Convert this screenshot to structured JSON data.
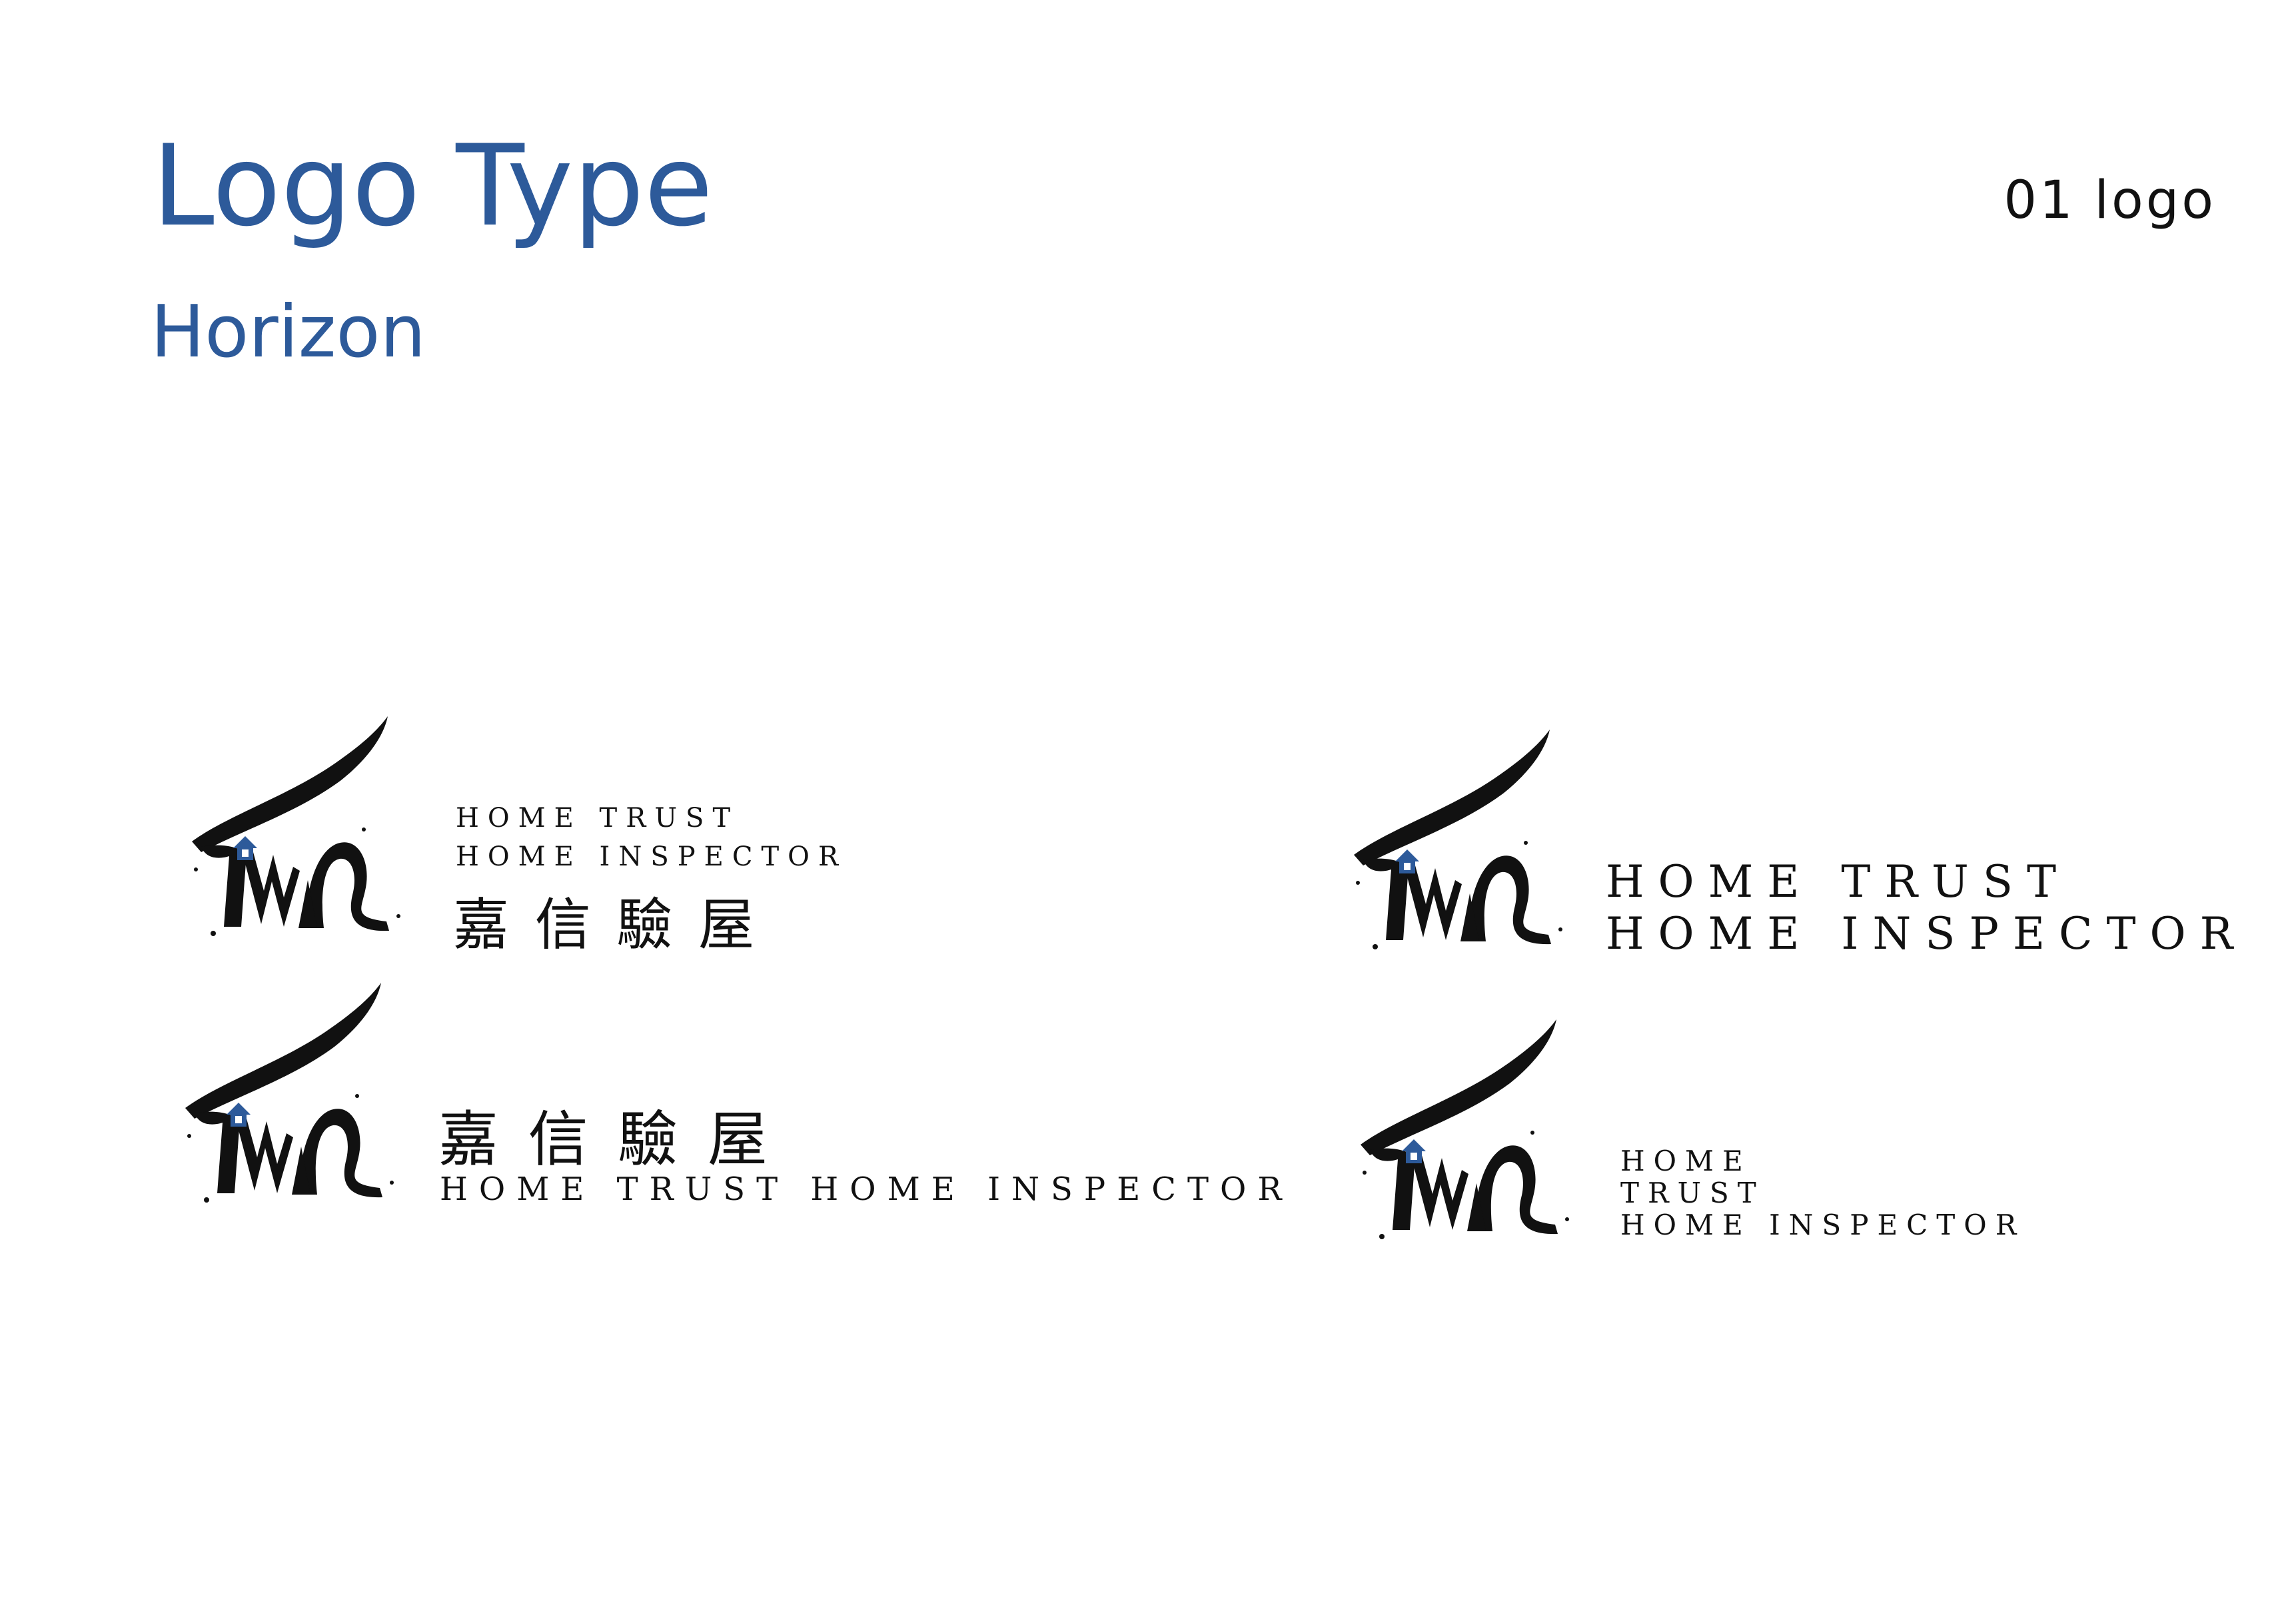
{
  "header": {
    "title": "Logo Type",
    "subtitle": "Horizon",
    "section_label": "01 logo"
  },
  "brand_colors": {
    "accent_blue": "#2d5a9a",
    "ink_black": "#111111"
  },
  "logo_mark": {
    "icon": "brush-ink-ht-monogram-with-blue-house",
    "house_color": "#2d5a9a"
  },
  "variants": [
    {
      "id": "stacked-en-over-cjk",
      "lines": [
        "HOME TRUST",
        "HOME INSPECTOR",
        "嘉 信 驗 屋"
      ]
    },
    {
      "id": "two-line-en",
      "lines": [
        "HOME TRUST",
        "HOME INSPECTOR"
      ]
    },
    {
      "id": "cjk-over-single-line-en",
      "lines": [
        "嘉 信 驗 屋",
        "HOME TRUST HOME INSPECTOR"
      ]
    },
    {
      "id": "three-line-en",
      "lines": [
        "HOME",
        "TRUST",
        "HOME INSPECTOR"
      ]
    }
  ]
}
